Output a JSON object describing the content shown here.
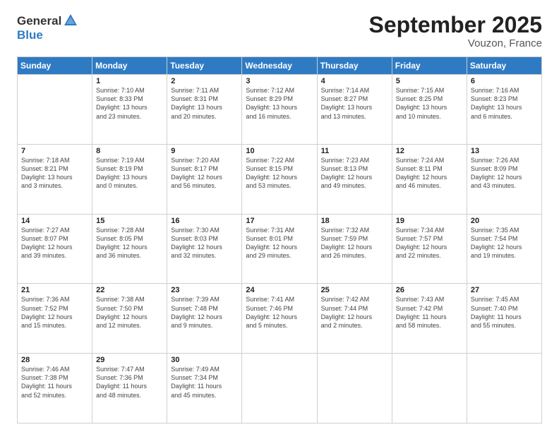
{
  "logo": {
    "general": "General",
    "blue": "Blue"
  },
  "title": "September 2025",
  "location": "Vouzon, France",
  "weekdays": [
    "Sunday",
    "Monday",
    "Tuesday",
    "Wednesday",
    "Thursday",
    "Friday",
    "Saturday"
  ],
  "weeks": [
    [
      {
        "day": "",
        "info": ""
      },
      {
        "day": "1",
        "info": "Sunrise: 7:10 AM\nSunset: 8:33 PM\nDaylight: 13 hours\nand 23 minutes."
      },
      {
        "day": "2",
        "info": "Sunrise: 7:11 AM\nSunset: 8:31 PM\nDaylight: 13 hours\nand 20 minutes."
      },
      {
        "day": "3",
        "info": "Sunrise: 7:12 AM\nSunset: 8:29 PM\nDaylight: 13 hours\nand 16 minutes."
      },
      {
        "day": "4",
        "info": "Sunrise: 7:14 AM\nSunset: 8:27 PM\nDaylight: 13 hours\nand 13 minutes."
      },
      {
        "day": "5",
        "info": "Sunrise: 7:15 AM\nSunset: 8:25 PM\nDaylight: 13 hours\nand 10 minutes."
      },
      {
        "day": "6",
        "info": "Sunrise: 7:16 AM\nSunset: 8:23 PM\nDaylight: 13 hours\nand 6 minutes."
      }
    ],
    [
      {
        "day": "7",
        "info": "Sunrise: 7:18 AM\nSunset: 8:21 PM\nDaylight: 13 hours\nand 3 minutes."
      },
      {
        "day": "8",
        "info": "Sunrise: 7:19 AM\nSunset: 8:19 PM\nDaylight: 13 hours\nand 0 minutes."
      },
      {
        "day": "9",
        "info": "Sunrise: 7:20 AM\nSunset: 8:17 PM\nDaylight: 12 hours\nand 56 minutes."
      },
      {
        "day": "10",
        "info": "Sunrise: 7:22 AM\nSunset: 8:15 PM\nDaylight: 12 hours\nand 53 minutes."
      },
      {
        "day": "11",
        "info": "Sunrise: 7:23 AM\nSunset: 8:13 PM\nDaylight: 12 hours\nand 49 minutes."
      },
      {
        "day": "12",
        "info": "Sunrise: 7:24 AM\nSunset: 8:11 PM\nDaylight: 12 hours\nand 46 minutes."
      },
      {
        "day": "13",
        "info": "Sunrise: 7:26 AM\nSunset: 8:09 PM\nDaylight: 12 hours\nand 43 minutes."
      }
    ],
    [
      {
        "day": "14",
        "info": "Sunrise: 7:27 AM\nSunset: 8:07 PM\nDaylight: 12 hours\nand 39 minutes."
      },
      {
        "day": "15",
        "info": "Sunrise: 7:28 AM\nSunset: 8:05 PM\nDaylight: 12 hours\nand 36 minutes."
      },
      {
        "day": "16",
        "info": "Sunrise: 7:30 AM\nSunset: 8:03 PM\nDaylight: 12 hours\nand 32 minutes."
      },
      {
        "day": "17",
        "info": "Sunrise: 7:31 AM\nSunset: 8:01 PM\nDaylight: 12 hours\nand 29 minutes."
      },
      {
        "day": "18",
        "info": "Sunrise: 7:32 AM\nSunset: 7:59 PM\nDaylight: 12 hours\nand 26 minutes."
      },
      {
        "day": "19",
        "info": "Sunrise: 7:34 AM\nSunset: 7:57 PM\nDaylight: 12 hours\nand 22 minutes."
      },
      {
        "day": "20",
        "info": "Sunrise: 7:35 AM\nSunset: 7:54 PM\nDaylight: 12 hours\nand 19 minutes."
      }
    ],
    [
      {
        "day": "21",
        "info": "Sunrise: 7:36 AM\nSunset: 7:52 PM\nDaylight: 12 hours\nand 15 minutes."
      },
      {
        "day": "22",
        "info": "Sunrise: 7:38 AM\nSunset: 7:50 PM\nDaylight: 12 hours\nand 12 minutes."
      },
      {
        "day": "23",
        "info": "Sunrise: 7:39 AM\nSunset: 7:48 PM\nDaylight: 12 hours\nand 9 minutes."
      },
      {
        "day": "24",
        "info": "Sunrise: 7:41 AM\nSunset: 7:46 PM\nDaylight: 12 hours\nand 5 minutes."
      },
      {
        "day": "25",
        "info": "Sunrise: 7:42 AM\nSunset: 7:44 PM\nDaylight: 12 hours\nand 2 minutes."
      },
      {
        "day": "26",
        "info": "Sunrise: 7:43 AM\nSunset: 7:42 PM\nDaylight: 11 hours\nand 58 minutes."
      },
      {
        "day": "27",
        "info": "Sunrise: 7:45 AM\nSunset: 7:40 PM\nDaylight: 11 hours\nand 55 minutes."
      }
    ],
    [
      {
        "day": "28",
        "info": "Sunrise: 7:46 AM\nSunset: 7:38 PM\nDaylight: 11 hours\nand 52 minutes."
      },
      {
        "day": "29",
        "info": "Sunrise: 7:47 AM\nSunset: 7:36 PM\nDaylight: 11 hours\nand 48 minutes."
      },
      {
        "day": "30",
        "info": "Sunrise: 7:49 AM\nSunset: 7:34 PM\nDaylight: 11 hours\nand 45 minutes."
      },
      {
        "day": "",
        "info": ""
      },
      {
        "day": "",
        "info": ""
      },
      {
        "day": "",
        "info": ""
      },
      {
        "day": "",
        "info": ""
      }
    ]
  ]
}
